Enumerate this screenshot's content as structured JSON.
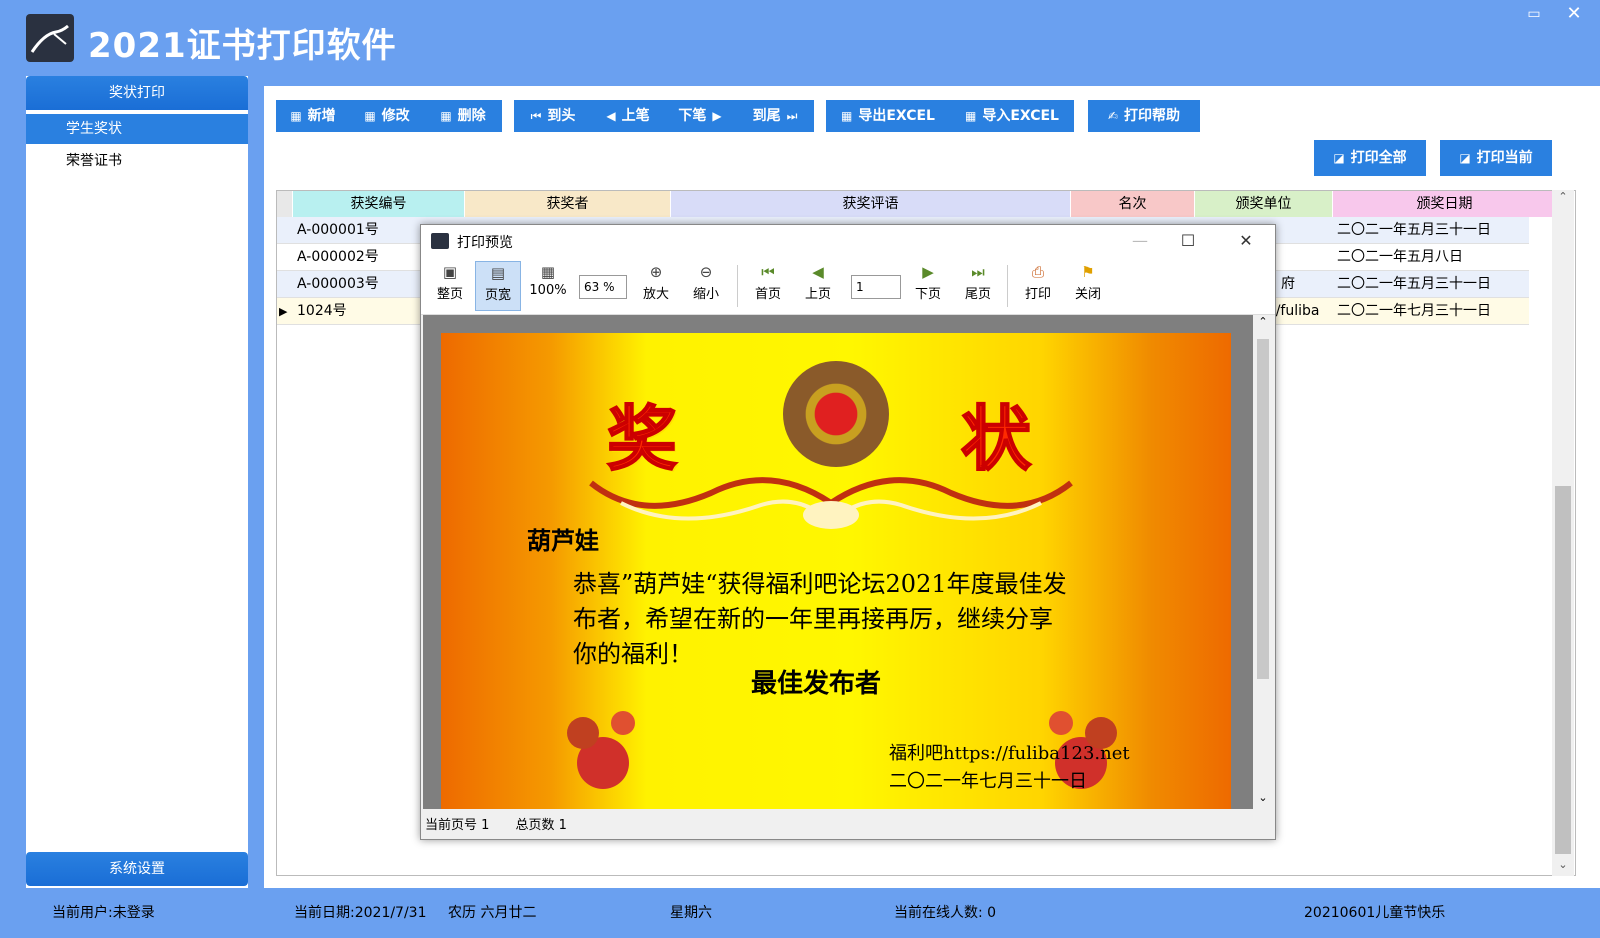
{
  "app": {
    "title": "2021证书打印软件",
    "window_max_icon": "maximize-icon",
    "window_close_icon": "close-icon"
  },
  "sidebar": {
    "top_header": "奖状打印",
    "items": [
      {
        "label": "学生奖状",
        "selected": true
      },
      {
        "label": "荣誉证书",
        "selected": false
      }
    ],
    "bottom_header": "系统设置"
  },
  "toolbar": {
    "add": "新增",
    "edit": "修改",
    "delete": "删除",
    "first": "到头",
    "prev": "上笔",
    "next": "下笔",
    "last": "到尾",
    "export_excel": "导出EXCEL",
    "import_excel": "导入EXCEL",
    "print_help": "打印帮助",
    "print_all": "打印全部",
    "print_current": "打印当前"
  },
  "table": {
    "columns": [
      {
        "label": "获奖编号",
        "color": "#b8f0f0"
      },
      {
        "label": "获奖者",
        "color": "#f8e8c8"
      },
      {
        "label": "获奖评语",
        "color": "#d8dcf8"
      },
      {
        "label": "名次",
        "color": "#f8c8c8"
      },
      {
        "label": "颁奖单位",
        "color": "#d8f0c8"
      },
      {
        "label": "颁奖日期",
        "color": "#f8c8ec"
      }
    ],
    "rows": [
      {
        "id": "A-000001号",
        "winner": "",
        "comment": "",
        "rank": "",
        "org": "",
        "date": "二〇二一年五月三十一日"
      },
      {
        "id": "A-000002号",
        "winner": "",
        "comment": "",
        "rank": "",
        "org": "",
        "date": "二〇二一年五月八日"
      },
      {
        "id": "A-000003号",
        "winner": "",
        "comment": "",
        "rank": "",
        "org": "府",
        "date": "二〇二一年五月三十一日"
      },
      {
        "id": "1024号",
        "winner": "",
        "comment": "",
        "rank": "",
        "org": "//fuliba",
        "date": "二〇二一年七月三十一日"
      }
    ],
    "current_row_marker": "▶"
  },
  "status_bar": {
    "user": "当前用户:未登录",
    "date": "当前日期:2021/7/31",
    "lunar": "农历 六月廿二",
    "weekday": "星期六",
    "online": "当前在线人数: 0",
    "slogan": "20210601儿童节快乐"
  },
  "preview": {
    "title": "打印预览",
    "buttons": {
      "whole_page": "整页",
      "page_width": "页宽",
      "actual_size": "100%",
      "zoom_in": "放大",
      "zoom_out": "缩小",
      "first_page": "首页",
      "prev_page": "上页",
      "next_page": "下页",
      "last_page": "尾页",
      "print": "打印",
      "close": "关闭"
    },
    "zoom_value": "63  %",
    "page_value": "1",
    "status_page": "当前页号  1",
    "status_total": "总页数  1",
    "certificate": {
      "title_left": "奖",
      "title_right": "状",
      "name": "葫芦娃",
      "body": "恭喜”葫芦娃“获得福利吧论坛2021年度最佳发布者，希望在新的一年里再接再厉，继续分享你的福利！",
      "award": "最佳发布者",
      "issuer": "福利吧https://fuliba123.net",
      "date": "二〇二一年七月三十一日"
    }
  }
}
